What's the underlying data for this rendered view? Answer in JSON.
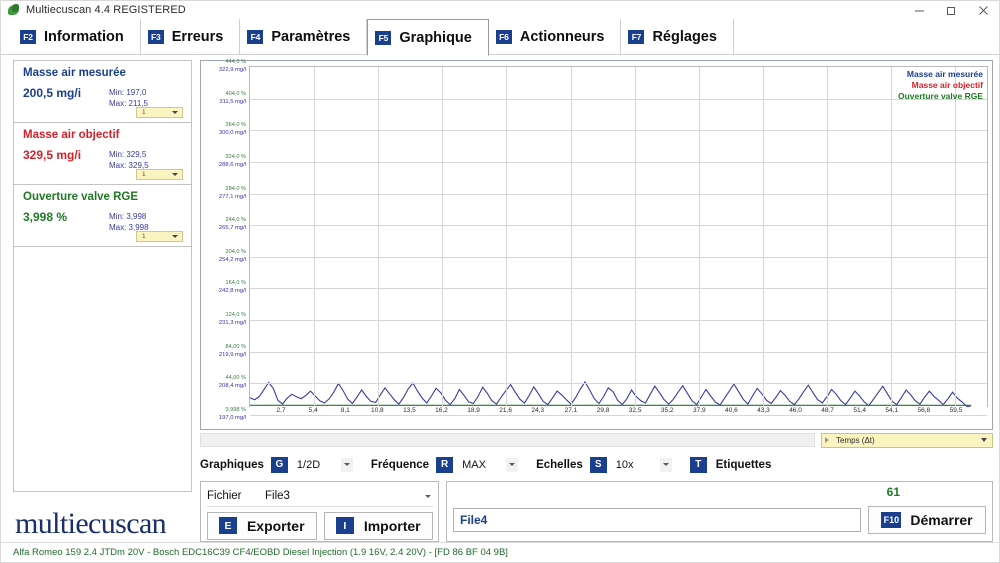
{
  "window": {
    "title": "Multiecuscan 4.4 REGISTERED",
    "icon": "leaf-icon",
    "minimize": "minimize-icon",
    "maximize": "maximize-icon",
    "close": "close-icon"
  },
  "tabs": [
    {
      "key": "F2",
      "label": "Information",
      "active": false
    },
    {
      "key": "F3",
      "label": "Erreurs",
      "active": false
    },
    {
      "key": "F4",
      "label": "Paramètres",
      "active": false
    },
    {
      "key": "F5",
      "label": "Graphique",
      "active": true
    },
    {
      "key": "F6",
      "label": "Actionneurs",
      "active": false
    },
    {
      "key": "F7",
      "label": "Réglages",
      "active": false
    }
  ],
  "sidebar": {
    "params": [
      {
        "title": "Masse air mesurée",
        "value": "200,5 mg/i",
        "min": "Min: 197,0",
        "max": "Max: 211,5",
        "selector": "1",
        "color": "#1b3f8f"
      },
      {
        "title": "Masse air objectif",
        "value": "329,5 mg/i",
        "min": "Min: 329,5",
        "max": "Max: 329,5",
        "selector": "1",
        "color": "#d4222a"
      },
      {
        "title": "Ouverture valve RGE",
        "value": "3,998 %",
        "min": "Min: 3,998",
        "max": "Max: 3,998",
        "selector": "1",
        "color": "#1f7a24"
      }
    ],
    "logo": "multiecuscan"
  },
  "chart_data": {
    "type": "line",
    "title": "",
    "xlabel": "",
    "ylabel": "",
    "grid": true,
    "legend_position": "top-right",
    "legend": [
      {
        "name": "Masse air mesurée",
        "color": "#1b3f8f"
      },
      {
        "name": "Masse air objectif",
        "color": "#d4222a"
      },
      {
        "name": "Ouverture valve RGE",
        "color": "#1f7a24"
      }
    ],
    "x_ticks": [
      "2,7",
      "5,4",
      "8,1",
      "10,8",
      "13,5",
      "16,2",
      "18,9",
      "21,6",
      "24,3",
      "27,1",
      "29,8",
      "32,5",
      "35,2",
      "37,9",
      "40,6",
      "43,3",
      "46,0",
      "48,7",
      "51,4",
      "54,1",
      "56,8",
      "59,5"
    ],
    "xlim": [
      0,
      62.2
    ],
    "y_ticks_pct": [
      "444,0 %",
      "404,0 %",
      "364,0 %",
      "324,0 %",
      "284,0 %",
      "244,0 %",
      "204,0 %",
      "164,0 %",
      "124,0 %",
      "84,00 %",
      "44,00 %",
      "3,998 %"
    ],
    "y_ticks_mgl": [
      "322,9 mg/l",
      "311,5 mg/l",
      "300,0 mg/l",
      "288,6 mg/l",
      "277,1 mg/l",
      "265,7 mg/l",
      "254,2 mg/l",
      "242,8 mg/l",
      "231,3 mg/l",
      "219,9 mg/l",
      "208,4 mg/l",
      "197,0 mg/l"
    ],
    "ylim_pct": [
      3.998,
      444.0
    ],
    "ylim_mgl": [
      197.0,
      322.9
    ],
    "series": [
      {
        "name": "Masse air mesurée",
        "color": "#3a3a9e",
        "unit": "mg/l",
        "values": [
          200.5,
          199.8,
          201.0,
          203.5,
          206.2,
          204.0,
          199.6,
          198.2,
          200.4,
          201.8,
          200.9,
          200.2,
          201.4,
          203.0,
          201.2,
          199.4,
          198.6,
          200.1,
          202.6,
          205.8,
          203.2,
          200.0,
          198.4,
          200.8,
          203.4,
          201.0,
          199.2,
          198.8,
          201.6,
          204.2,
          202.0,
          199.8,
          198.2,
          200.6,
          203.8,
          206.0,
          203.0,
          200.4,
          198.6,
          201.2,
          204.0,
          202.4,
          199.6,
          198.0,
          200.2,
          203.6,
          201.4,
          199.0,
          198.4,
          201.0,
          204.4,
          202.2,
          199.4,
          198.2,
          200.8,
          203.2,
          205.4,
          202.6,
          200.0,
          198.6,
          201.4,
          204.6,
          202.0,
          199.2,
          198.0,
          200.4,
          203.0,
          201.6,
          199.8,
          198.2,
          200.6,
          203.8,
          206.4,
          203.4,
          200.2,
          198.4,
          201.0,
          204.2,
          202.8,
          199.6,
          198.0,
          200.2,
          203.4,
          201.0,
          199.4,
          198.6,
          201.8,
          204.8,
          202.4,
          199.8,
          198.2,
          200.0,
          202.6,
          205.0,
          202.2,
          199.4,
          198.0,
          200.8,
          203.6,
          201.2,
          199.0,
          197.8,
          200.4,
          203.0,
          205.6,
          202.8,
          200.0,
          198.2,
          201.2,
          204.0,
          202.0,
          199.6,
          198.4,
          200.6,
          203.2,
          201.4,
          199.2,
          198.0,
          200.2,
          202.8,
          205.2,
          202.4,
          199.8,
          198.6,
          201.0,
          203.6,
          201.8,
          199.4,
          198.0,
          200.4,
          203.0,
          201.2,
          199.0,
          197.6,
          200.0,
          202.4,
          204.8,
          202.0,
          199.2,
          198.0,
          200.6,
          203.4,
          201.6,
          199.4,
          198.2,
          200.8,
          203.0,
          201.0,
          199.6,
          198.0,
          200.2,
          202.6,
          200.4,
          199.0,
          197.4,
          197.0
        ]
      },
      {
        "name": "Masse air objectif",
        "color": "#d4222a",
        "unit": "mg/l",
        "values": [
          329.5
        ]
      },
      {
        "name": "Ouverture valve RGE",
        "color": "#1f7a24",
        "unit": "%",
        "values": [
          3.998
        ]
      }
    ]
  },
  "scroll": {
    "temps_label": "Temps (Δt)",
    "left_arrow": "chevron-right-icon",
    "dropdown_arrow": "chevron-down-icon"
  },
  "controls": {
    "graphiques": {
      "label": "Graphiques",
      "key": "G",
      "value": "1/2D"
    },
    "frequence": {
      "label": "Fréquence",
      "key": "R",
      "value": "MAX"
    },
    "echelles": {
      "label": "Echelles",
      "key": "S",
      "value": "10x"
    },
    "etiquettes": {
      "label": "Etiquettes",
      "key": "T"
    }
  },
  "filepanel": {
    "fichier_label": "Fichier",
    "fichier_value": "File3",
    "exporter": {
      "key": "E",
      "label": "Exporter"
    },
    "importer": {
      "key": "I",
      "label": "Importer"
    }
  },
  "runpanel": {
    "counter": "61",
    "filename": "File4",
    "start": {
      "key": "F10",
      "label": "Démarrer"
    }
  },
  "statusbar": {
    "text": "Alfa Romeo 159 2.4 JTDm 20V - Bosch EDC16C39 CF4/EOBD Diesel Injection (1.9 16V, 2.4 20V) - [FD 86 BF 04 9B]"
  }
}
